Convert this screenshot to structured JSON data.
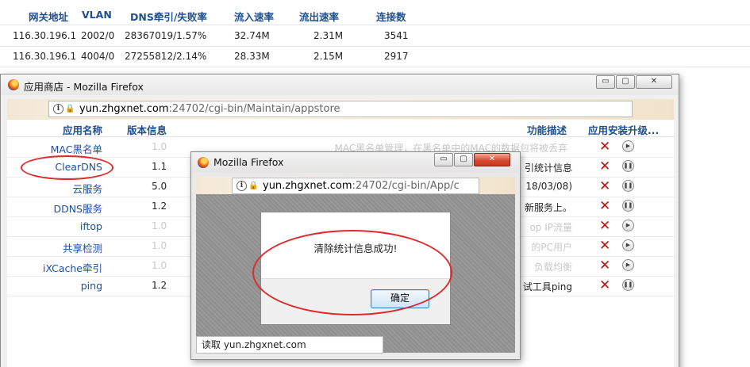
{
  "gateway_table": {
    "headers": [
      "网关地址",
      "VLAN",
      "DNS牵引/失败率",
      "流入速率",
      "流出速率",
      "连接数"
    ],
    "rows": [
      [
        "116.30.196.1",
        "2002/0",
        "28367019/1.57%",
        "32.74M",
        "2.31M",
        "3541"
      ],
      [
        "116.30.196.1",
        "4004/0",
        "27255812/2.14%",
        "28.33M",
        "2.15M",
        "2917"
      ]
    ]
  },
  "appstore_window": {
    "title": "应用商店 - Mozilla Firefox",
    "url_domain": "yun.zhgxnet.com",
    "url_rest": ":24702/cgi-bin/Maintain/appstore",
    "table_headers": {
      "name": "应用名称",
      "version": "版本信息",
      "description": "功能描述",
      "install": "应用安装升级..."
    },
    "apps": [
      {
        "name": "MAC黑名单",
        "version": "1.0",
        "description": "MAC黑名单管理，在黑名单中的MAC的数据包将被丢弃",
        "enabled": false
      },
      {
        "name": "ClearDNS",
        "version": "1.1",
        "description": "引统计信息",
        "enabled": true
      },
      {
        "name": "云服务",
        "version": "5.0",
        "description": "18/03/08)",
        "enabled": true
      },
      {
        "name": "DDNS服务",
        "version": "1.2",
        "description": "新服务上。",
        "enabled": true
      },
      {
        "name": "iftop",
        "version": "1.0",
        "description": "op IP流量",
        "enabled": false
      },
      {
        "name": "共享检测",
        "version": "1.0",
        "description": "的PC用户",
        "enabled": false
      },
      {
        "name": "iXCache牵引",
        "version": "1.0",
        "description": "负载均衡",
        "enabled": false
      },
      {
        "name": "ping",
        "version": "1.2",
        "description": "试工具ping",
        "enabled": true
      }
    ]
  },
  "dialog_window": {
    "title": "Mozilla Firefox",
    "url_domain": "yun.zhgxnet.com",
    "url_rest": ":24702/cgi-bin/App/c",
    "message": "清除统计信息成功!",
    "ok_label": "确定",
    "status_text": "读取 yun.zhgxnet.com"
  },
  "window_controls": {
    "minimize": "▭",
    "maximize": "▢",
    "close": "✕"
  },
  "icons": {
    "firefox": "firefox-icon",
    "remove": "✕",
    "play": "▶",
    "pause": "❚❚"
  },
  "colors": {
    "header_blue": "#1f4f8f",
    "link_blue": "#1f4fa0",
    "annotation_red": "#e02a2a",
    "remove_red": "#c01010"
  }
}
